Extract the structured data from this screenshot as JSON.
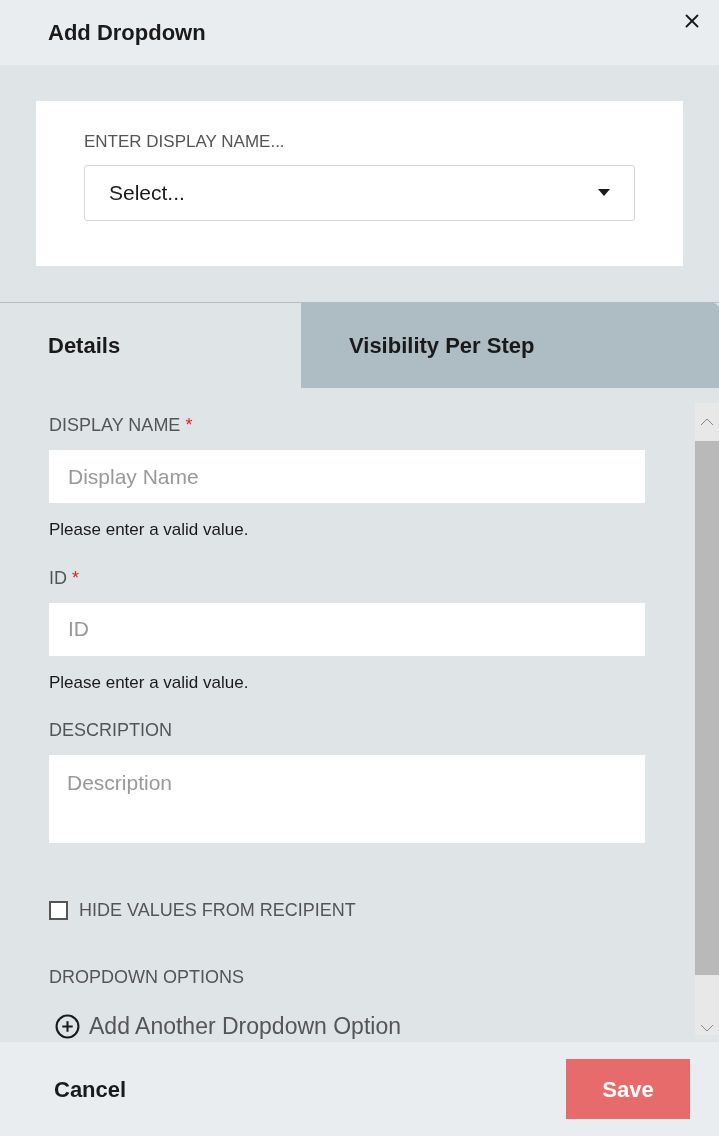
{
  "dialog": {
    "title": "Add Dropdown"
  },
  "selector": {
    "label": "ENTER DISPLAY NAME...",
    "value": "Select..."
  },
  "tabs": [
    {
      "label": "Details",
      "selected": true
    },
    {
      "label": "Visibility Per Step",
      "selected": false
    }
  ],
  "fields": [
    {
      "kind": "input",
      "label": "DISPLAY NAME",
      "required_mark": "*",
      "placeholder": "Display Name",
      "error": "Please enter a valid value."
    },
    {
      "kind": "input",
      "label": "ID",
      "required_mark": "*",
      "placeholder": "ID",
      "error": "Please enter a valid value."
    },
    {
      "kind": "textarea",
      "label": "DESCRIPTION",
      "placeholder": "Description"
    }
  ],
  "hide_values": {
    "label": "HIDE VALUES FROM RECIPIENT",
    "checked": false
  },
  "dropdown_options": {
    "label": "DROPDOWN OPTIONS",
    "add_label": "Add Another Dropdown Option"
  },
  "footer": {
    "cancel": "Cancel",
    "save": "Save"
  }
}
